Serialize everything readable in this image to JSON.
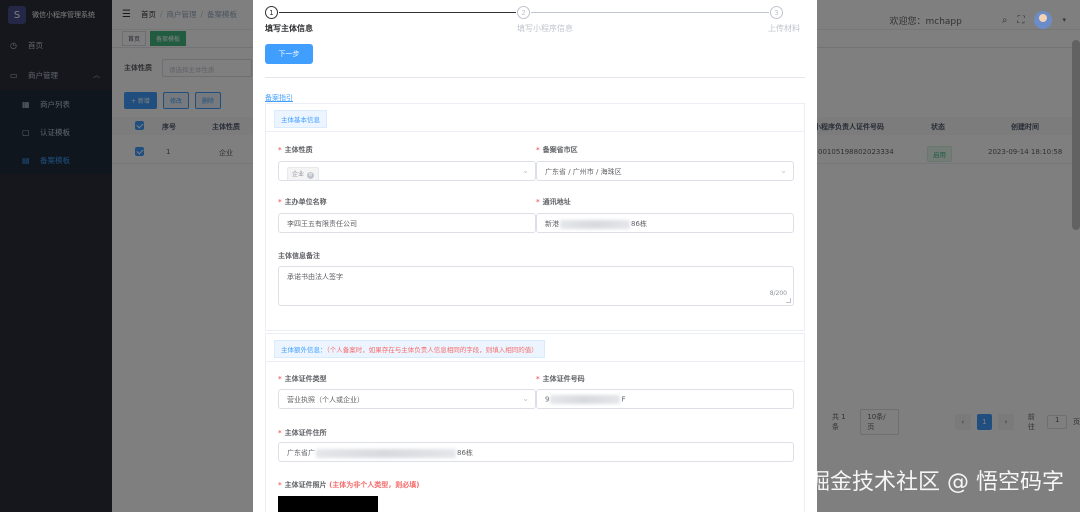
{
  "sidebar": {
    "app_title": "微信小程序管理系统",
    "logo_glyph": "S",
    "items": [
      {
        "label": "首页",
        "icon": "dashboard-icon"
      },
      {
        "label": "商户管理",
        "icon": "shop-icon"
      },
      {
        "label": "商户列表",
        "icon": "list-icon"
      },
      {
        "label": "认证模板",
        "icon": "template-icon"
      },
      {
        "label": "备案模板",
        "icon": "record-icon"
      }
    ]
  },
  "navbar": {
    "breadcrumb": [
      "首页",
      "商户管理",
      "备案模板"
    ],
    "welcome": "欢迎您：mchapp"
  },
  "tags": [
    "首页",
    "备案模板"
  ],
  "filter": {
    "label": "主体性质",
    "placeholder": "请选择主体性质"
  },
  "toolbar": {
    "add": "+ 新增",
    "edit": "修改",
    "delete": "删除"
  },
  "table": {
    "headers": [
      "序号",
      "主体性质",
      "小程序负责人证件号码",
      "状态",
      "创建时间"
    ],
    "rows": [
      {
        "index": "1",
        "nature": "企业",
        "id_number": "00105198802023334",
        "status": "启用",
        "created": "2023-09-14 18:10:58"
      }
    ]
  },
  "pagination": {
    "total": "共 1 条",
    "page_size": "10条/页",
    "current": "1",
    "goto_label": "前往",
    "goto_value": "1",
    "page_unit": "页"
  },
  "dialog": {
    "steps": [
      {
        "num": "1",
        "label": "填写主体信息"
      },
      {
        "num": "2",
        "label": "填写小程序信息"
      },
      {
        "num": "3",
        "label": "上传材料"
      }
    ],
    "next_button": "下一步",
    "guide_link": "备案指引",
    "basic_section": {
      "title": "主体基本信息",
      "nature_label": "主体性质",
      "nature_value": "企业",
      "region_label": "备案省市区",
      "region_value": "广东省 / 广州市 / 海珠区",
      "org_name_label": "主办单位名称",
      "org_name_value": "李四王五有限责任公司",
      "address_label": "通讯地址",
      "address_prefix": "新港",
      "address_suffix": "86栋",
      "remark_label": "主体信息备注",
      "remark_value": "承诺书由法人签字",
      "remark_count": "8/200"
    },
    "extra_section": {
      "title": "主体额外信息：",
      "note": "（个人备案时，如果存在与主体负责人信息相同的字段，则填入相同的值）",
      "cert_type_label": "主体证件类型",
      "cert_type_value": "营业执照（个人或企业）",
      "cert_no_label": "主体证件号码",
      "cert_no_prefix": "9",
      "cert_no_suffix": "F",
      "cert_addr_label": "主体证件住所",
      "cert_addr_prefix": "广东省广",
      "cert_addr_suffix": "86栋",
      "photo_label": "主体证件照片",
      "photo_note": "(主体为非个人类型，则必填)"
    }
  },
  "watermark": "掘金技术社区 @ 悟空码字"
}
